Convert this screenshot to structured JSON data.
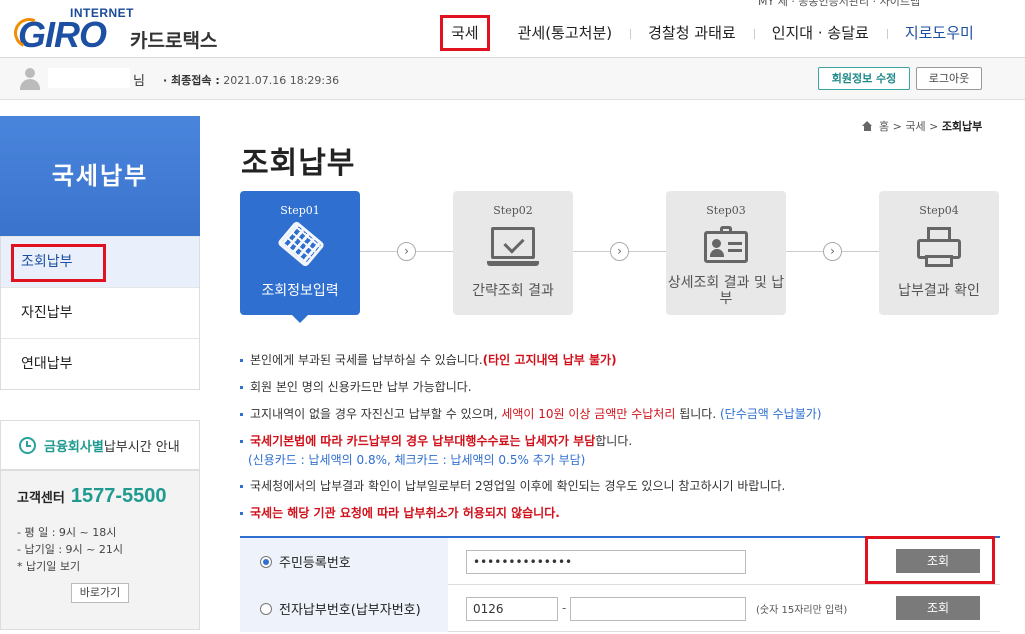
{
  "header": {
    "top_util": "MY 세 · 공동인증서관리 · 사이트맵",
    "logo": {
      "internet": "INTERNET",
      "giro": "GIRO",
      "sub": "카드로택스"
    },
    "gnb": [
      "국세",
      "관세(통고처분)",
      "경찰청 과태료",
      "인지대 · 송달료",
      "지로도우미"
    ]
  },
  "userbar": {
    "name_suffix": "님",
    "last_login_label": "· 최종접속 :",
    "last_login_value": "2021.07.16 18:29:36",
    "edit_button": "회원정보 수정",
    "logout_button": "로그아웃"
  },
  "sidebar": {
    "title": "국세납부",
    "items": [
      "조회납부",
      "자진납부",
      "연대납부"
    ],
    "notice": {
      "highlight": "금융회사별",
      "rest": " 납부시간 안내"
    },
    "cs": {
      "label": "고객센터",
      "phone": "1577-5500",
      "hours": [
        "- 평   일 : 9시 ~ 18시",
        "- 납기일 : 9시 ~ 21시",
        "  * 납기일 보기"
      ],
      "go_button": "바로가기"
    }
  },
  "breadcrumb": {
    "home": "홈",
    "sep1": ">",
    "level1": "국세",
    "sep2": ">",
    "current": "조회납부"
  },
  "page_title": "조회납부",
  "steps": [
    {
      "num": "Step01",
      "label": "조회정보입력"
    },
    {
      "num": "Step02",
      "label": "간략조회 결과"
    },
    {
      "num": "Step03",
      "label": "상세조회 결과 및 납부"
    },
    {
      "num": "Step04",
      "label": "납부결과 확인"
    }
  ],
  "info": {
    "line1_a": "본인에게 부과된 국세를 납부하실 수 있습니다.",
    "line1_b": "(타인 고지내역 납부 불가)",
    "line2": "회원 본인 명의 신용카드만 납부 가능합니다.",
    "line3_a": "고지내역이 없을 경우 자진신고 납부할 수 있으며, ",
    "line3_b": "세액이 10원 이상 금액만 수납처리",
    "line3_c": " 됩니다. ",
    "line3_d": "(단수금액 수납불가)",
    "line4_a": "국세기본법에 따라 카드납부의 경우 납부대행수수료는 납세자가 부담",
    "line4_b": "합니다.",
    "line4_sub": "(신용카드 : 납세액의 0.8%, 체크카드 : 납세액의 0.5% 추가 부담)",
    "line5": "국세청에서의 납부결과 확인이 납부일로부터 2영업일 이후에 확인되는 경우도 있으니 참고하시기 바랍니다.",
    "line6": "국세는 해당 기관 요청에 따라 납부취소가 허용되지 않습니다."
  },
  "form": {
    "row1": {
      "label": "주민등록번호",
      "value": "••••••••••••••",
      "button": "조회"
    },
    "row2": {
      "label": "전자납부번호(납부자번호)",
      "value1": "0126",
      "dash": "-",
      "value2": "",
      "hint": "(숫자 15자리만 입력)",
      "button": "조회"
    }
  }
}
